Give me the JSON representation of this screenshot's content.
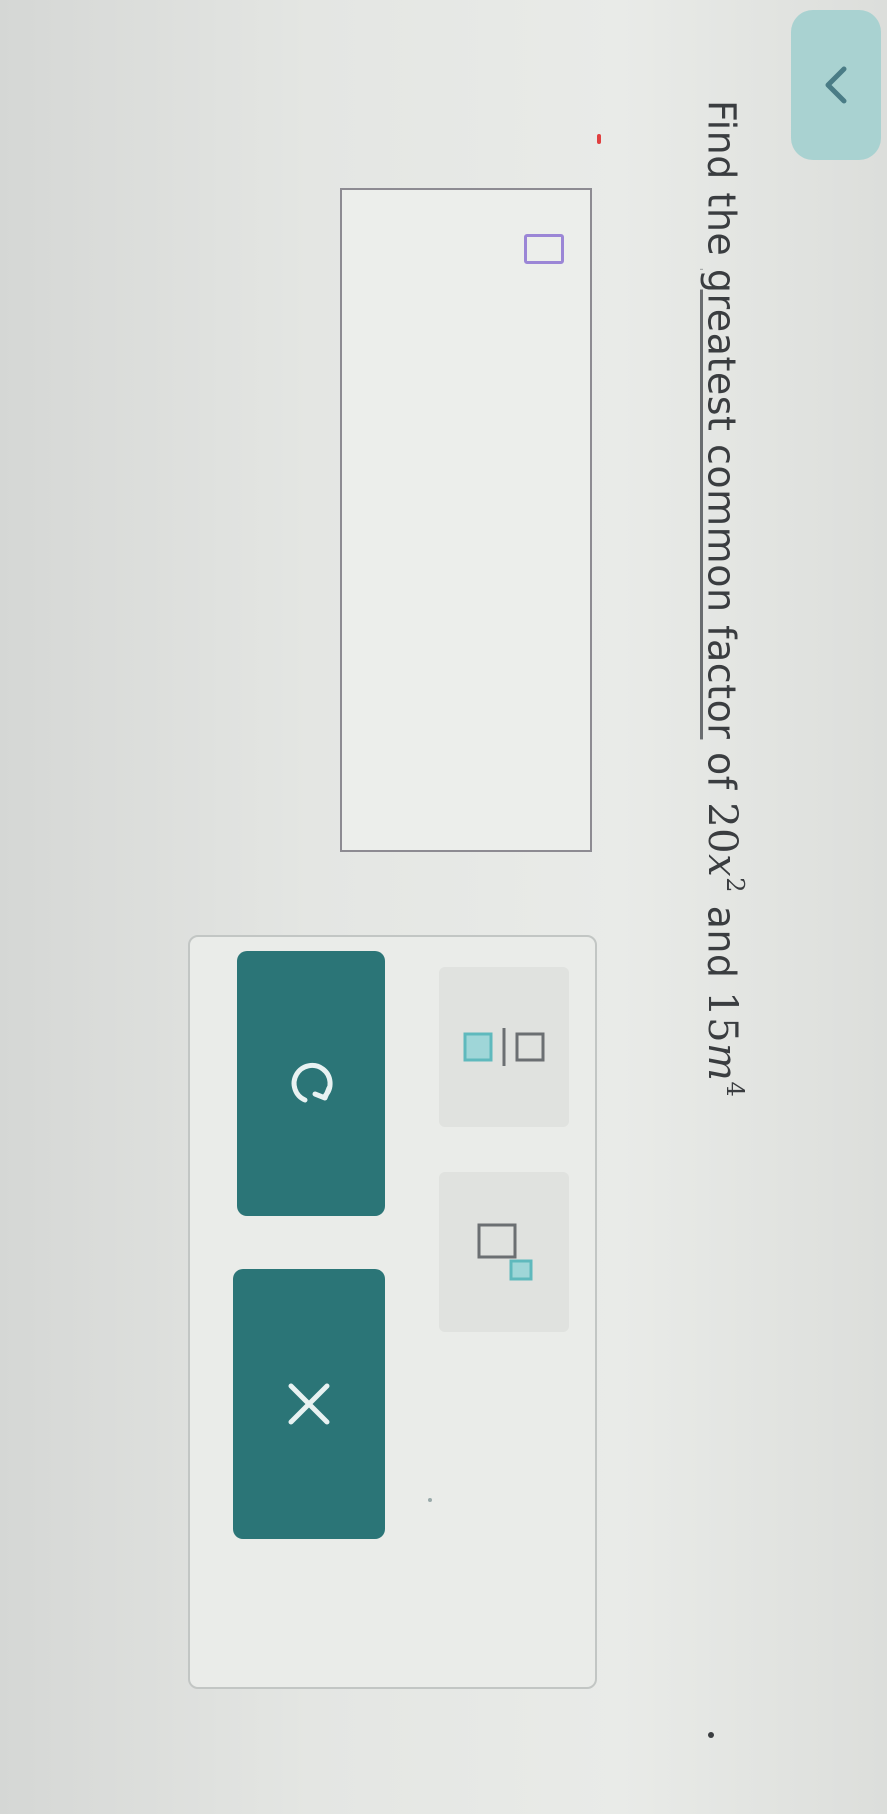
{
  "prompt": {
    "prefix": "Find the ",
    "link_text": "greatest common factor",
    "middle": " of ",
    "term1_coeff": "20",
    "term1_var": "x",
    "term1_exp": "2",
    "conjunction": " and ",
    "term2_coeff": "15",
    "term2_var": "m",
    "term2_exp": "4",
    "suffix": "."
  },
  "answer": {
    "value": ""
  },
  "toolbar": {
    "tools": [
      "fraction-icon",
      "exponent-icon"
    ],
    "undo_icon": "undo-icon",
    "clear_icon": "close-icon"
  },
  "colors": {
    "accent": "#2b7577",
    "cursor": "#9b86d6",
    "tab": "#a9d2d1",
    "template_box": "#5fb9bd"
  }
}
